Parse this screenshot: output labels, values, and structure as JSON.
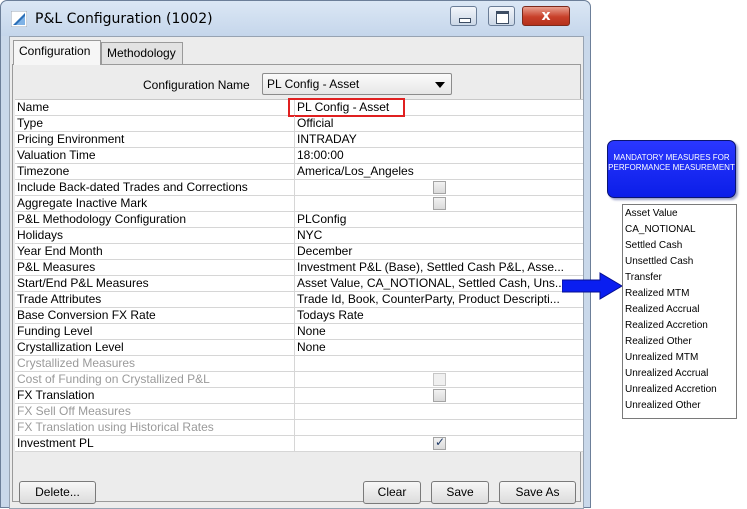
{
  "window": {
    "title": "P&L Configuration (1002)",
    "close_symbol": "x",
    "icon": "app-triangle-icon"
  },
  "tabs": [
    {
      "label": "Configuration",
      "active": true
    },
    {
      "label": "Methodology",
      "active": false
    }
  ],
  "config": {
    "label": "Configuration Name",
    "selected": "PL Config - Asset"
  },
  "rows": [
    {
      "name": "Name",
      "value": "PL Config - Asset",
      "disabled": false
    },
    {
      "name": "Type",
      "value": "Official",
      "disabled": false
    },
    {
      "name": "Pricing Environment",
      "value": "INTRADAY",
      "disabled": false
    },
    {
      "name": "Valuation Time",
      "value": "18:00:00",
      "disabled": false
    },
    {
      "name": "Timezone",
      "value": "America/Los_Angeles",
      "disabled": false
    },
    {
      "name": "Include Back-dated Trades and Corrections",
      "value": "",
      "checkbox": "unchecked",
      "disabled": false
    },
    {
      "name": "Aggregate Inactive Mark",
      "value": "",
      "checkbox": "unchecked",
      "disabled": false
    },
    {
      "name": "P&L Methodology Configuration",
      "value": "PLConfig",
      "disabled": false
    },
    {
      "name": "Holidays",
      "value": "NYC",
      "disabled": false
    },
    {
      "name": "Year End Month",
      "value": "December",
      "disabled": false
    },
    {
      "name": "P&L Measures",
      "value": "Investment P&L (Base), Settled Cash P&L, Asse...",
      "disabled": false
    },
    {
      "name": "Start/End P&L Measures",
      "value": "Asset Value, CA_NOTIONAL, Settled Cash, Uns...",
      "disabled": false
    },
    {
      "name": "Trade Attributes",
      "value": "Trade Id, Book, CounterParty, Product Descripti...",
      "disabled": false
    },
    {
      "name": "Base Conversion FX Rate",
      "value": "Todays Rate",
      "disabled": false
    },
    {
      "name": "Funding Level",
      "value": "None",
      "disabled": false
    },
    {
      "name": "Crystallization Level",
      "value": "None",
      "disabled": false
    },
    {
      "name": "Crystallized Measures",
      "value": "",
      "disabled": true
    },
    {
      "name": "Cost of Funding on Crystallized P&L",
      "value": "",
      "checkbox": "disabled",
      "disabled": true
    },
    {
      "name": "FX Translation",
      "value": "",
      "checkbox": "unchecked",
      "disabled": false
    },
    {
      "name": "FX Sell Off Measures",
      "value": "",
      "disabled": true
    },
    {
      "name": "FX Translation using Historical Rates",
      "value": "",
      "disabled": true
    },
    {
      "name": "Investment PL",
      "value": "",
      "checkbox": "checked",
      "disabled": false
    }
  ],
  "buttons": {
    "delete": "Delete...",
    "clear": "Clear",
    "save": "Save",
    "save_as": "Save As"
  },
  "annotation": {
    "callout": "MANDATORY MEASURES FOR PERFORMANCE MEASUREMENT",
    "callout_color": "#1a2cf5",
    "highlight_color": "#e02020",
    "arrow": "right-arrow-icon",
    "measures": [
      "Asset Value",
      "CA_NOTIONAL",
      "Settled Cash",
      "Unsettled Cash",
      "Transfer",
      "Realized MTM",
      "Realized Accrual",
      "Realized Accretion",
      "Realized Other",
      "Unrealized MTM",
      "Unrealized Accrual",
      "Unrealized Accretion",
      "Unrealized Other"
    ]
  }
}
